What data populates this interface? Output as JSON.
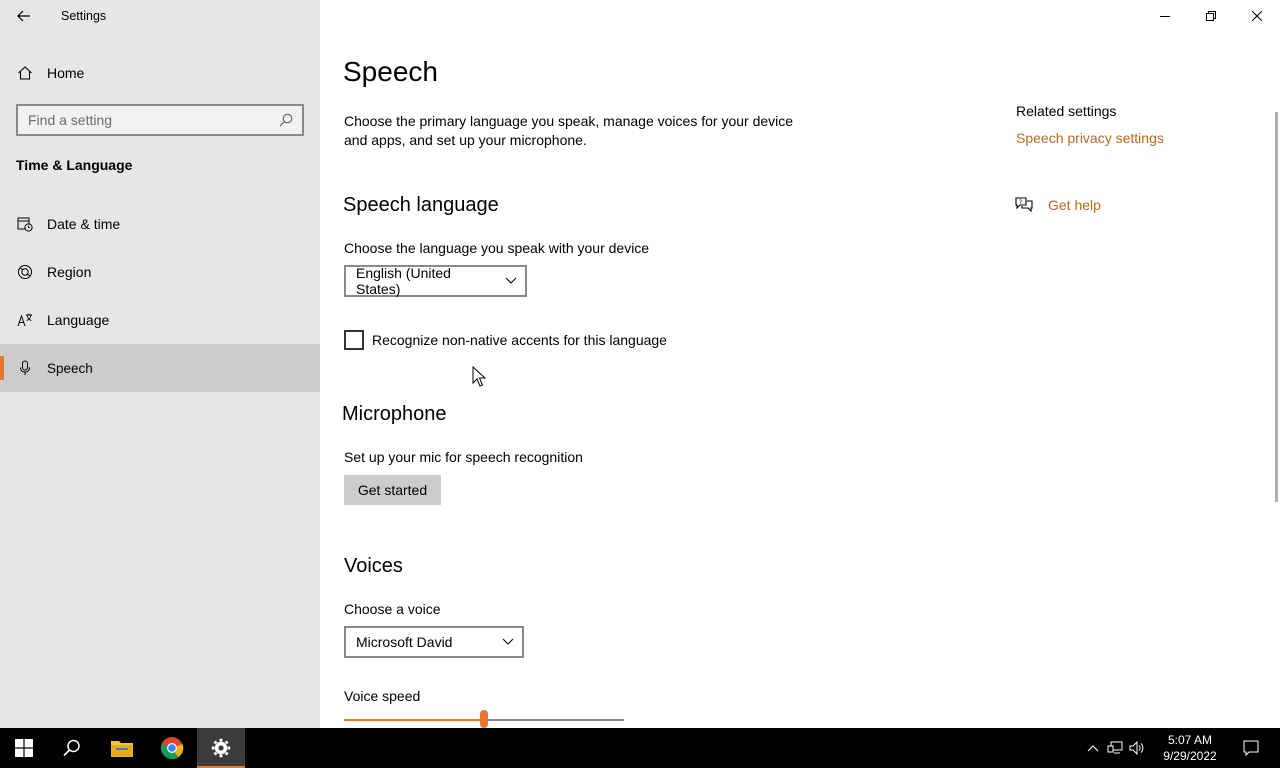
{
  "window": {
    "app_title": "Settings"
  },
  "sidebar": {
    "home_label": "Home",
    "search_placeholder": "Find a setting",
    "section_title": "Time & Language",
    "items": [
      {
        "label": "Date & time",
        "icon": "date-time-icon",
        "selected": false
      },
      {
        "label": "Region",
        "icon": "globe-icon",
        "selected": false
      },
      {
        "label": "Language",
        "icon": "language-icon",
        "selected": false
      },
      {
        "label": "Speech",
        "icon": "microphone-icon",
        "selected": true
      }
    ]
  },
  "main": {
    "title": "Speech",
    "description": "Choose the primary language you speak, manage voices for your device and apps, and set up your microphone.",
    "speech_language": {
      "heading": "Speech language",
      "label": "Choose the language you speak with your device",
      "selected_value": "English (United States)",
      "checkbox_label": "Recognize non-native accents for this language",
      "checkbox_checked": false
    },
    "microphone": {
      "heading": "Microphone",
      "label": "Set up your mic for speech recognition",
      "button_label": "Get started"
    },
    "voices": {
      "heading": "Voices",
      "choose_label": "Choose a voice",
      "selected_voice": "Microsoft David",
      "speed_label": "Voice speed",
      "speed_fraction": 0.5
    }
  },
  "related": {
    "title": "Related settings",
    "privacy_link": "Speech privacy settings",
    "help_link": "Get help"
  },
  "taskbar": {
    "time": "5:07 AM",
    "date": "9/29/2022",
    "apps": [
      "start-icon",
      "search-icon",
      "file-explorer-icon",
      "chrome-icon",
      "settings-icon"
    ]
  },
  "colors": {
    "accent": "#e9762b",
    "link": "#b56a23",
    "sidebar_bg": "#e6e6e6",
    "selected_bg": "#cccccc"
  }
}
